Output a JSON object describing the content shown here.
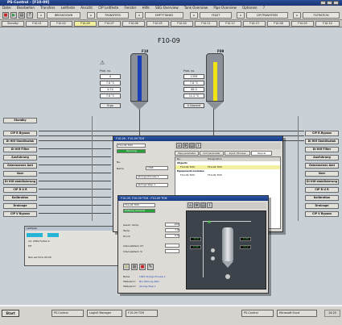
{
  "window": {
    "title": "PS-Control - [F10-09]"
  },
  "menu": [
    "Datei",
    "Bearbeiten",
    "Transfers",
    "Leitfeste",
    "Ansicht",
    "CIP Leitfeste",
    "Fenster",
    "Hilfe",
    "SEG-Overview",
    "Tank Overview",
    "Pipe Overview",
    "Optionen",
    "?"
  ],
  "toolbar": {
    "breakdown": "BREAKDOWN",
    "transfers": "TRANSFERS",
    "empty_tanks": "EMPTYTANKS",
    "yeast": "YEAST",
    "cip_transfers": "CIP/TRANSFERS",
    "filtration": "FILTRATION"
  },
  "tabs": [
    "Standby",
    "F10-01",
    "F10-02",
    "F10-09",
    "F10-07",
    "F10-06",
    "F10-05",
    "F10-04",
    "F10-11",
    "F10-12",
    "F10-13",
    "F10-08",
    "F10-03",
    "F10-10"
  ],
  "active_tab": "F10-09",
  "main": {
    "title": "F10-09",
    "tank_left": {
      "name": "F10",
      "params_title": "Prod. no.",
      "values": [
        "0",
        "7.8 °C",
        "0.74",
        "7.8 °C"
      ],
      "status": "Ergo"
    },
    "tank_right": {
      "name": "F09",
      "params_title": "Prod. no.",
      "values": [
        "1359",
        "7.8 °C",
        "69.3",
        "11.2 °C"
      ],
      "status": "0 Gaerent"
    },
    "left_buttons": [
      "Standby",
      "CIP R Bypass",
      "Dl Hilf Stabilisatok",
      "Dl Hilf Filter",
      "Ausfuhrung",
      "Gemessenes Amt",
      "Voer",
      "Dl Hilf stabilisierung",
      "CIP R U R",
      "Kalibration",
      "Drainage",
      "CIP V Bypass"
    ],
    "right_buttons": [
      "CIP R Bypass",
      "Dl Hilf Stabilisatok",
      "Dl Hilf Filter",
      "Ausfuhrung",
      "Gemessenes Amt",
      "Voer",
      "Dl Hilf stabilisierung",
      "CIP R U R",
      "Kalibration",
      "Drainage",
      "CIP V Bypass"
    ],
    "info_panel": {
      "title": "Leitfeste",
      "line1": "int. 2059 Fertiel 0",
      "line2": "MT",
      "line3": "Nav set time 00:00"
    }
  },
  "dialog1": {
    "title": "F10-09 - F10-09 TCM",
    "header_field": "F10-09 TCM",
    "status": "Running",
    "tabs": [
      "Step parameter",
      "Unit parameter",
      "Input / Process",
      "Objects"
    ],
    "active_tab": "Objects",
    "label_no": "No.",
    "label_name": "Name",
    "no_value": "1365",
    "name_value": "Abrings Process 1",
    "name_value2": "Abrings Step 1",
    "table_headers": [
      "No.",
      "Designation"
    ],
    "table_rows": [
      {
        "no": "Objects",
        "name": ""
      },
      {
        "no": "F10-09 TCM",
        "name": "F10-09 TCM"
      },
      {
        "no": "Equipment modules",
        "name": ""
      },
      {
        "no": "F10-09 TCM",
        "name": "F10-09 TCM"
      }
    ]
  },
  "dialog2": {
    "title": "F10-09, F10-09 TCM - F10-09 TCM",
    "field1": "F10-09 TCM",
    "field2": "Kühlung (Anlauf)",
    "rows": [
      {
        "label": "Gesch. temp.",
        "value": "100"
      },
      {
        "label": "Temp.",
        "value": "7.8"
      },
      {
        "label": "Druck",
        "value": "0.0"
      },
      {
        "label": "Intervall/tank UT",
        "value": ""
      },
      {
        "label": "Intervall/tank 3r",
        "value": ""
      }
    ],
    "footer": [
      {
        "label": "Name",
        "value": "1365  Abrings Process 1"
      },
      {
        "label": "Statusart 1",
        "value": "Nur Kühlung aktiv"
      },
      {
        "label": "Statusart 2",
        "value": "Abrings Step 1"
      }
    ],
    "readings": [
      "15.8",
      "0.00",
      "0.00",
      "11.2"
    ]
  },
  "taskbar": {
    "start": "Start",
    "items": [
      "PS-Control",
      "Logix5 Manager",
      "F10-09 TCM",
      "PS-Control",
      "Microsoft Excel"
    ],
    "clock": "14:25"
  },
  "colors": {
    "canvas": "#c9d1d7",
    "title": "#1f3f88",
    "active_tab": "#f3f0a0",
    "tank_blue": "#1a3eb8",
    "tank_yellow": "#f2e412",
    "green": "#27a03a"
  }
}
